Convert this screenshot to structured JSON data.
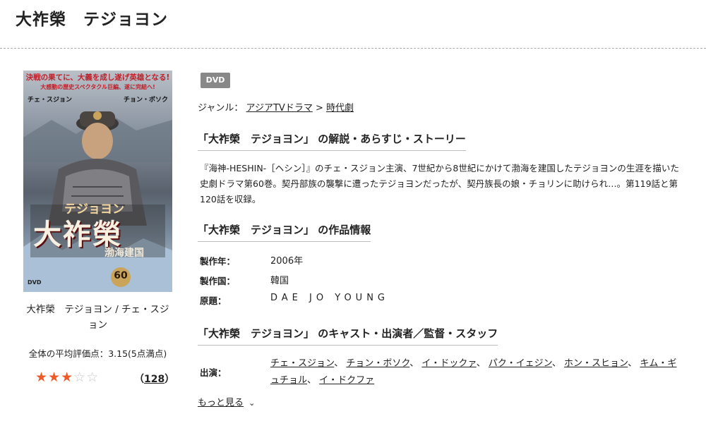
{
  "page": {
    "title": "大祚榮　テジョヨン"
  },
  "cover": {
    "tagline": "決戦の果てに、大義を成し遂げ英雄となる!",
    "subtagline": "大感動の歴史スペクタクル巨編、遂に完結へ!",
    "actor_left": "チェ・スジョン",
    "actor_right": "チョン・ボソク",
    "title_kana": "テジョヨン",
    "title_kanji": "大祚榮",
    "subtitle": "渤海建国",
    "volume": "60",
    "format_mark": "DVD"
  },
  "caption": "大祚榮　テジョヨン / チェ・スジョン",
  "rating": {
    "label": "全体の平均評価点：3.15(5点満点)",
    "stars_filled": 3,
    "stars_total": 5,
    "review_count": "128"
  },
  "badge": "DVD",
  "genre": {
    "label": "ジャンル：",
    "items": [
      "アジアTVドラマ",
      "時代劇"
    ],
    "separator": ">"
  },
  "sections": {
    "synopsis_heading": "「大祚榮　テジョヨン」 の解説・あらすじ・ストーリー",
    "synopsis_text": "『海神-HESHIN-［ヘシン］』のチェ・スジョン主演、7世紀から8世紀にかけて渤海を建国したテジョヨンの生涯を描いた史劇ドラマ第60巻。契丹部族の襲撃に遭ったテジョヨンだったが、契丹族長の娘・チョリンに助けられ…。第119話と第120話を収録。",
    "info_heading": "「大祚榮　テジョヨン」 の作品情報",
    "cast_heading": "「大祚榮　テジョヨン」 のキャスト・出演者／監督・スタッフ"
  },
  "info": {
    "year_label": "製作年：",
    "year_value": "2006年",
    "country_label": "製作国：",
    "country_value": "韓国",
    "original_label": "原題：",
    "original_value": "DAE JO YOUNG"
  },
  "cast": {
    "label": "出演：",
    "members": [
      "チェ・スジョン",
      "チョン・ボソク",
      "イ・ドックァ",
      "パク・イェジン",
      "ホン・スヒョン",
      "キム・ギュチョル",
      "イ・ドクファ"
    ],
    "separator": "、"
  },
  "more": {
    "label": "もっと見る"
  },
  "colors": {
    "star": "#f05a28",
    "badge": "#888888"
  }
}
